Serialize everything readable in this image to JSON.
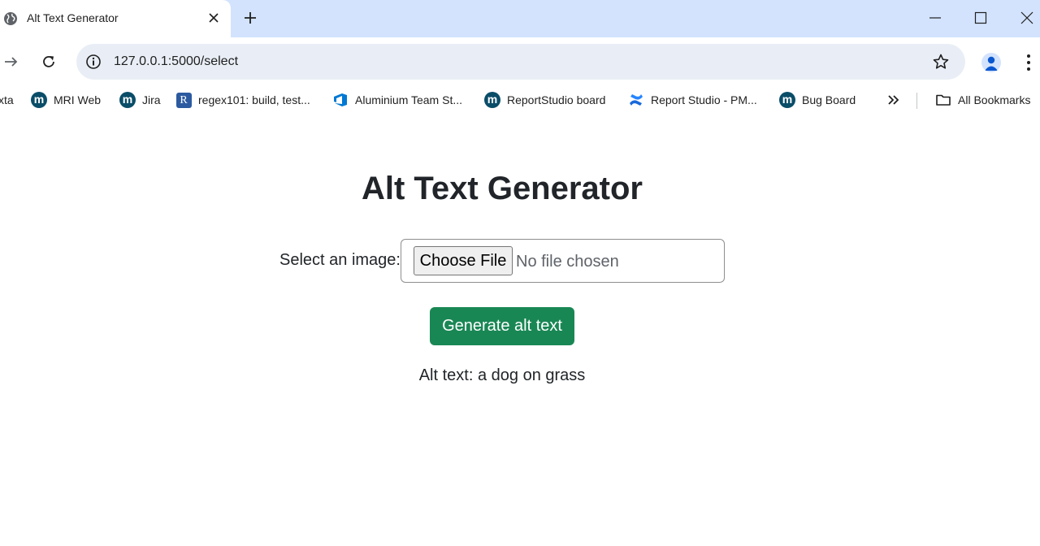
{
  "browser": {
    "tab": {
      "title": "Alt Text Generator"
    },
    "address_bar": {
      "url": "127.0.0.1:5000/select"
    },
    "bookmarks": [
      {
        "label": "xta",
        "icon": "none"
      },
      {
        "label": "MRI Web",
        "icon": "m-logo-icon"
      },
      {
        "label": "Jira",
        "icon": "m-logo-icon"
      },
      {
        "label": "regex101: build, test...",
        "icon": "r-logo-icon"
      },
      {
        "label": "Aluminium Team St...",
        "icon": "azure-devops-icon"
      },
      {
        "label": "ReportStudio board",
        "icon": "m-logo-icon"
      },
      {
        "label": "Report Studio - PM...",
        "icon": "confluence-icon"
      },
      {
        "label": "Bug Board",
        "icon": "m-logo-icon"
      }
    ],
    "all_bookmarks_label": "All Bookmarks"
  },
  "page": {
    "title": "Alt Text Generator",
    "select_label": "Select an image:",
    "file_input": {
      "button_label": "Choose File",
      "status": "No file chosen"
    },
    "generate_button": "Generate alt text",
    "result_text": "Alt text: a dog on grass"
  },
  "colors": {
    "tabstrip": "#d3e3fd",
    "omnibox": "#e9eef6",
    "primary_button": "#198754",
    "bookmark_m_icon": "#0a4d68"
  }
}
